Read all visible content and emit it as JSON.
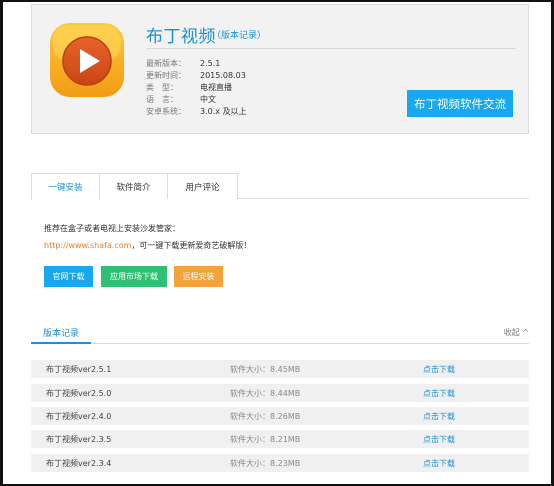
{
  "app": {
    "title": "布丁视频",
    "version_link": "（版本记录）",
    "info": [
      {
        "label": "最新版本：",
        "value": "2.5.1"
      },
      {
        "label": "更新时间：",
        "value": "2015.08.03"
      },
      {
        "label": "类　型：",
        "value": "电视直播"
      },
      {
        "label": "语　言：",
        "value": "中文"
      },
      {
        "label": "安卓系统：",
        "value": "3.0.x 及以上"
      }
    ],
    "exchange_button": "布丁视频软件交流",
    "icon": "play-icon",
    "accent_color": "#1c8fd8",
    "icon_colors": {
      "outer": "#f7a81b",
      "inner": "#d6521d"
    }
  },
  "tabs": [
    {
      "label": "一键安装",
      "active": true
    },
    {
      "label": "软件简介",
      "active": false
    },
    {
      "label": "用户评论",
      "active": false
    }
  ],
  "install": {
    "recommend_text": "推荐在盒子或者电视上安装沙发管家：",
    "shafa_url": "http://www.shafa.com",
    "shafa_suffix": "，可一键下载更新爱奇艺破解版！",
    "buttons": {
      "official": "官网下载",
      "market": "应用市场下载",
      "remote": "远程安装"
    }
  },
  "version_history": {
    "title": "版本记录",
    "collapse": "收起 ^",
    "size_label": "软件大小：",
    "download_label": "点击下载",
    "rows": [
      {
        "name": "布丁视频ver2.5.1",
        "size": "8.45MB"
      },
      {
        "name": "布丁视频ver2.5.0",
        "size": "8.44MB"
      },
      {
        "name": "布丁视频ver2.4.0",
        "size": "8.26MB"
      },
      {
        "name": "布丁视频ver2.3.5",
        "size": "8.21MB"
      },
      {
        "name": "布丁视频ver2.3.4",
        "size": "8.23MB"
      }
    ]
  }
}
